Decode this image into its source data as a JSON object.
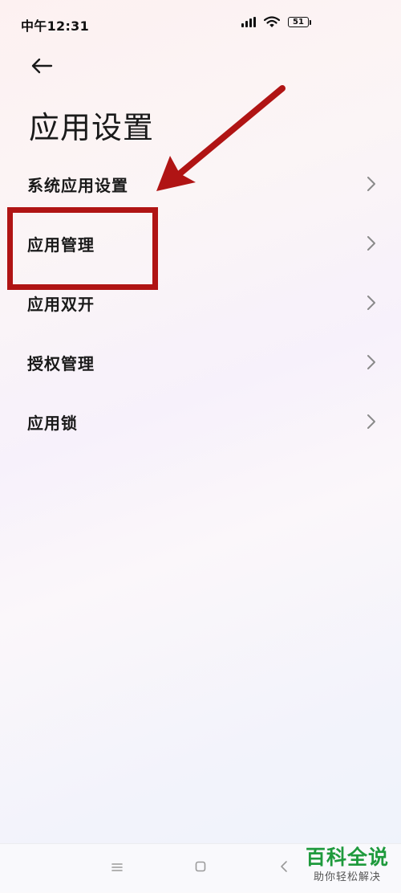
{
  "status_bar": {
    "time": "中午12:31",
    "battery_level": "51",
    "icons": [
      "signal-icon",
      "wifi-icon",
      "battery-icon"
    ]
  },
  "header": {
    "back_icon": "arrow-left-icon",
    "title": "应用设置"
  },
  "menu": {
    "items": [
      {
        "label": "系统应用设置",
        "icon": "chevron-right-icon"
      },
      {
        "label": "应用管理",
        "icon": "chevron-right-icon"
      },
      {
        "label": "应用双开",
        "icon": "chevron-right-icon"
      },
      {
        "label": "授权管理",
        "icon": "chevron-right-icon"
      },
      {
        "label": "应用锁",
        "icon": "chevron-right-icon"
      }
    ]
  },
  "annotation": {
    "highlight_color": "#b01414",
    "arrow_color": "#b01414",
    "highlighted_item": "应用管理"
  },
  "nav_bar": {
    "icons": [
      "menu-icon",
      "home-icon",
      "back-icon"
    ]
  },
  "watermark": {
    "main": "百科全说",
    "sub": "助你轻松解决",
    "color": "#1e9a3c"
  }
}
